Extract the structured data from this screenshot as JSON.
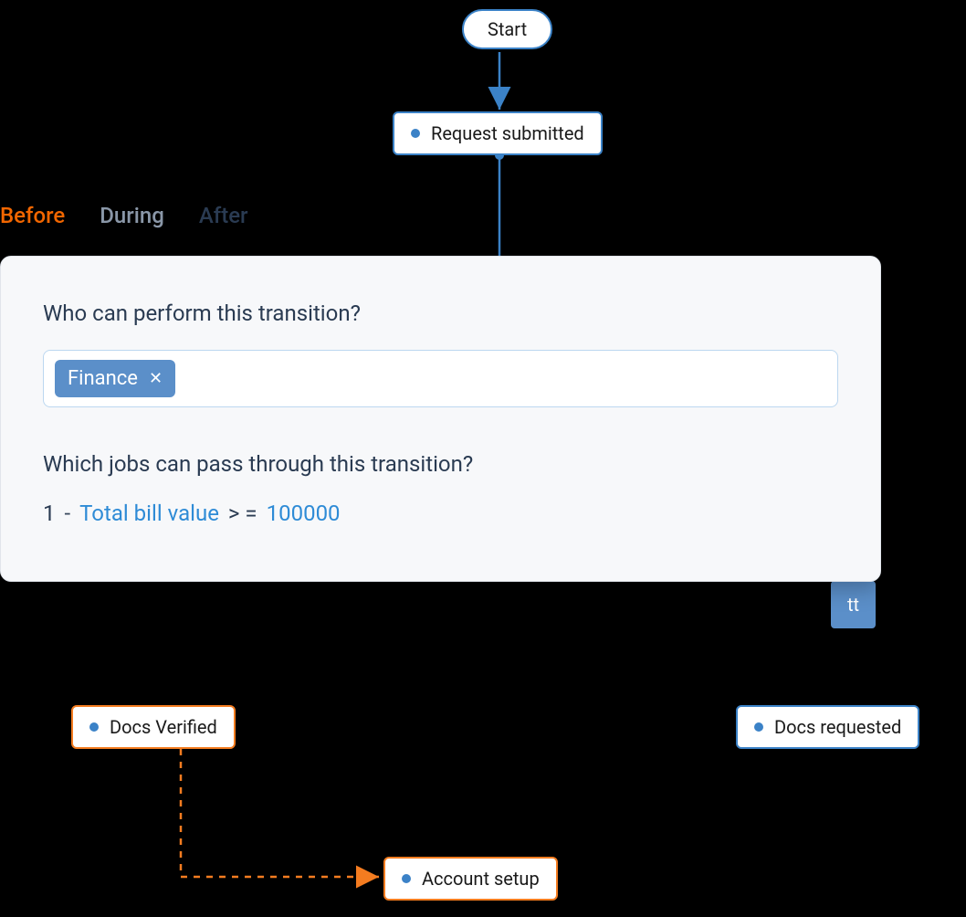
{
  "nodes": {
    "start": "Start",
    "request_submitted": "Request submitted",
    "docs_verified": "Docs Verified",
    "docs_requested": "Docs requested",
    "account_setup": "Account setup"
  },
  "tabs": {
    "before": "Before",
    "during": "During",
    "after": "After"
  },
  "panel": {
    "q1": "Who can perform this transition?",
    "tag": "Finance",
    "q2": "Which jobs can pass through this transition?",
    "rule": {
      "index": "1",
      "dash": "-",
      "field": "Total bill value",
      "operator": "> =",
      "value": "100000"
    }
  },
  "partial_button_text": "tt",
  "colors": {
    "blue": "#3b82c7",
    "orange": "#f47c20",
    "tag_bg": "#5b8fc9",
    "link": "#2e8bd6",
    "active_tab": "#f26600"
  }
}
